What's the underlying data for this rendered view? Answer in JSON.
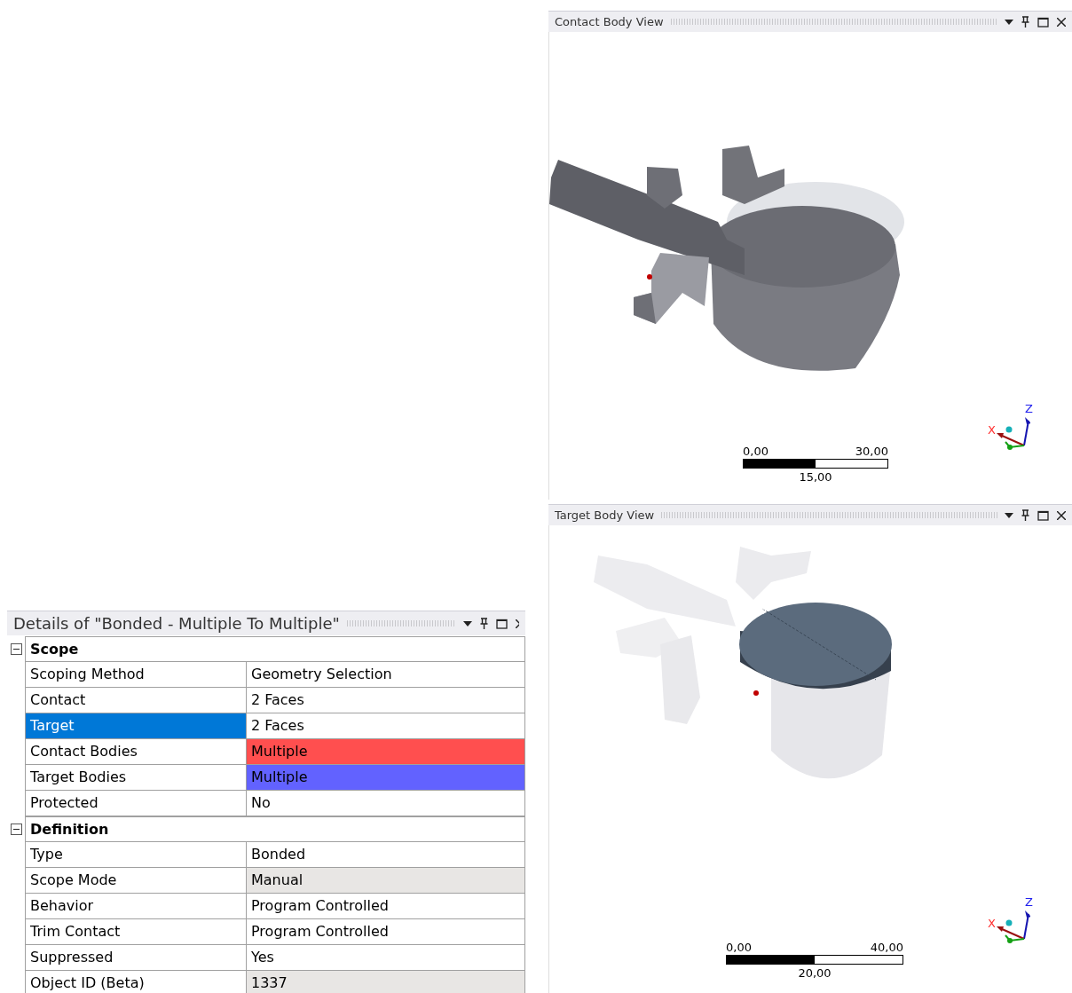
{
  "details": {
    "title": "Details of \"Bonded - Multiple To Multiple\"",
    "sections": [
      {
        "label": "Scope",
        "expanded": true,
        "rows": [
          {
            "name": "Scoping Method",
            "value": "Geometry Selection",
            "selected": false,
            "readonly": false
          },
          {
            "name": "Contact",
            "value": "2 Faces",
            "selected": false,
            "readonly": false
          },
          {
            "name": "Target",
            "value": "2 Faces",
            "selected": true,
            "readonly": false
          },
          {
            "name": "Contact Bodies",
            "value": "Multiple",
            "selected": false,
            "readonly": false,
            "color": "#ff4f4f"
          },
          {
            "name": "Target Bodies",
            "value": "Multiple",
            "selected": false,
            "readonly": false,
            "color": "#6262ff"
          },
          {
            "name": "Protected",
            "value": "No",
            "selected": false,
            "readonly": false
          }
        ]
      },
      {
        "label": "Definition",
        "expanded": true,
        "rows": [
          {
            "name": "Type",
            "value": "Bonded",
            "selected": false,
            "readonly": false
          },
          {
            "name": "Scope Mode",
            "value": "Manual",
            "selected": false,
            "readonly": true
          },
          {
            "name": "Behavior",
            "value": "Program Controlled",
            "selected": false,
            "readonly": false
          },
          {
            "name": "Trim Contact",
            "value": "Program Controlled",
            "selected": false,
            "readonly": false
          },
          {
            "name": "Suppressed",
            "value": "Yes",
            "selected": false,
            "readonly": false
          },
          {
            "name": "Object ID (Beta)",
            "value": "1337",
            "selected": false,
            "readonly": true
          }
        ]
      }
    ]
  },
  "views": [
    {
      "kind": "contact",
      "title": "Contact Body View",
      "scale": {
        "start": "0,00",
        "end": "30,00",
        "middle": "15,00"
      },
      "triad": {
        "x": "X",
        "z": "Z"
      }
    },
    {
      "kind": "target",
      "title": "Target Body View",
      "scale": {
        "start": "0,00",
        "end": "40,00",
        "middle": "20,00"
      },
      "triad": {
        "x": "X",
        "z": "Z"
      }
    }
  ]
}
